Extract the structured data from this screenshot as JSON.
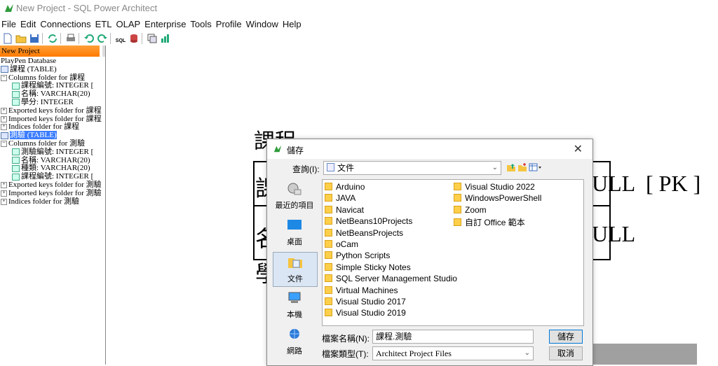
{
  "window": {
    "title": "New Project - SQL Power Architect"
  },
  "menu": [
    "File",
    "Edit",
    "Connections",
    "ETL",
    "OLAP",
    "Enterprise",
    "Tools",
    "Profile",
    "Window",
    "Help"
  ],
  "toolbar": {
    "icons": [
      "new-file-icon",
      "open-folder-icon",
      "save-icon",
      "refresh-icon",
      "print-icon",
      "undo-icon",
      "redo-icon",
      "sql-icon",
      "db-icon",
      "copy-icon",
      "chart-icon"
    ],
    "sql_label": "SQL"
  },
  "left_panel": {
    "tab": "New Project",
    "tree": [
      {
        "text": "PlayPen Database",
        "indent": 0,
        "type": "root"
      },
      {
        "text": "課程 (TABLE)",
        "indent": 0,
        "type": "table"
      },
      {
        "text": "Columns folder for 課程",
        "indent": 0,
        "type": "folder-open"
      },
      {
        "text": "課程編號: INTEGER [",
        "indent": 2,
        "type": "column"
      },
      {
        "text": "名稱: VARCHAR(20)",
        "indent": 2,
        "type": "column"
      },
      {
        "text": "學分: INTEGER",
        "indent": 2,
        "type": "column"
      },
      {
        "text": "Exported keys folder for 課程",
        "indent": 0,
        "type": "folder"
      },
      {
        "text": "Imported keys folder for 課程",
        "indent": 0,
        "type": "folder"
      },
      {
        "text": "Indices folder for 課程",
        "indent": 0,
        "type": "folder"
      },
      {
        "text": "測驗 (TABLE)",
        "indent": 0,
        "type": "table",
        "selected": true
      },
      {
        "text": "Columns folder for 測驗",
        "indent": 0,
        "type": "folder-open"
      },
      {
        "text": "測驗編號: INTEGER [",
        "indent": 2,
        "type": "column"
      },
      {
        "text": "名稱: VARCHAR(20)",
        "indent": 2,
        "type": "column"
      },
      {
        "text": "種類: VARCHAR(20)",
        "indent": 2,
        "type": "column"
      },
      {
        "text": "課程編號: INTEGER [",
        "indent": 2,
        "type": "column"
      },
      {
        "text": "Exported keys folder for 測驗",
        "indent": 0,
        "type": "folder"
      },
      {
        "text": "Imported keys folder for 測驗",
        "indent": 0,
        "type": "folder"
      },
      {
        "text": "Indices folder for 測驗",
        "indent": 0,
        "type": "folder"
      }
    ]
  },
  "playpen": {
    "table_title": "課程",
    "row1_left": "課",
    "row1_right": "ULL  [ PK ]",
    "row2_left": "名",
    "row2_right": "ULL",
    "row3_left": "學"
  },
  "dialog": {
    "title": "儲存",
    "lookin_label": "查詢(I):",
    "lookin_value": "文件",
    "places": [
      "最近的項目",
      "桌面",
      "文件",
      "本機",
      "網路"
    ],
    "files_col1": [
      "Arduino",
      "JAVA",
      "Navicat",
      "NetBeans10Projects",
      "NetBeansProjects",
      "oCam",
      "Python Scripts",
      "Simple Sticky Notes",
      "SQL Server Management Studio",
      "Virtual Machines",
      "Visual Studio 2017",
      "Visual Studio 2019"
    ],
    "files_col2": [
      "Visual Studio 2022",
      "WindowsPowerShell",
      "Zoom",
      "自訂 Office 範本"
    ],
    "filename_label": "檔案名稱(N):",
    "filename_value": "課程.測驗",
    "filetype_label": "檔案類型(T):",
    "filetype_value": "Architect Project Files",
    "save_button": "儲存",
    "cancel_button": "取消"
  }
}
